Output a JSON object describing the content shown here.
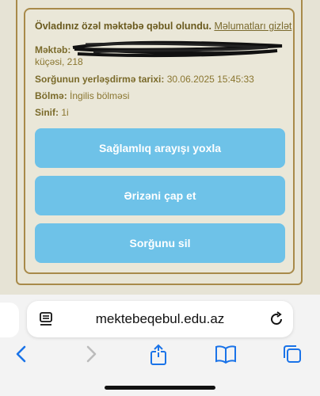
{
  "notice": {
    "text": "Övladınız özəl məktəbə qəbul olundu.",
    "link": "Məlumatları gizlət"
  },
  "fields": {
    "school_label": "Məktəb",
    "school_value_line2": "küçəsi, 218",
    "date_label": "Sorğunun yerləşdirmə tarixi",
    "date_value": "30.06.2025 15:45:33",
    "section_label": "Bölmə",
    "section_value": "İngilis bölməsi",
    "class_label": "Sinif",
    "class_value": "1i"
  },
  "buttons": {
    "health_check": "Sağlamlıq arayışı yoxla",
    "print": "Ərizəni çap et",
    "delete": "Sorğunu sil"
  },
  "browser": {
    "url": "mektebeqebul.edu.az"
  },
  "colors": {
    "button": "#6ec2e8",
    "accent_ios": "#1a73e8",
    "border": "#a88a4a"
  },
  "icons": [
    "page-menu-icon",
    "reload-icon",
    "back-icon",
    "forward-icon",
    "share-icon",
    "bookmarks-icon",
    "tabs-icon"
  ]
}
